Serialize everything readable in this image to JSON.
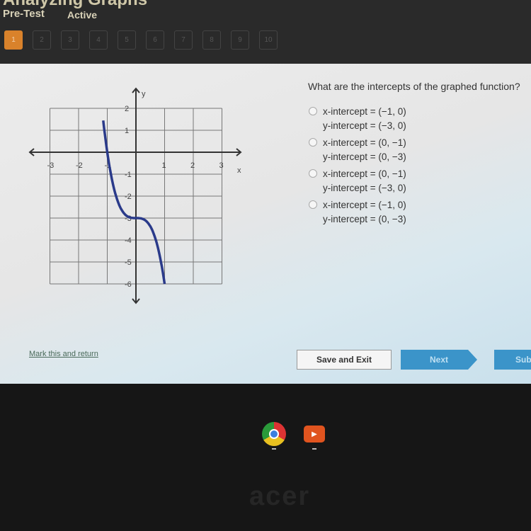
{
  "header": {
    "title": "Analyzing Graphs",
    "mode": "Pre-Test",
    "status": "Active"
  },
  "questions": [
    "1",
    "2",
    "3",
    "4",
    "5",
    "6",
    "7",
    "8",
    "9",
    "10"
  ],
  "current_question": 1,
  "question": "What are the intercepts of the graphed function?",
  "options": [
    {
      "x": "x-intercept = (−1, 0)",
      "y": "y-intercept = (−3, 0)"
    },
    {
      "x": "x-intercept = (0, −1)",
      "y": "y-intercept = (0, −3)"
    },
    {
      "x": "x-intercept = (0, −1)",
      "y": "y-intercept = (−3, 0)"
    },
    {
      "x": "x-intercept = (−1, 0)",
      "y": "y-intercept = (0, −3)"
    }
  ],
  "graph": {
    "xlabel": "x",
    "ylabel": "y",
    "xticks": [
      "-3",
      "-2",
      "-1",
      "1",
      "2",
      "3"
    ],
    "yticks": [
      "2",
      "1",
      "-1",
      "-2",
      "-3",
      "-4",
      "-5",
      "-6"
    ],
    "xlim": [
      -3,
      3
    ],
    "ylim": [
      -6,
      2
    ],
    "function": "y = -3x^3 - 3",
    "curve_color": "#2a3a8a"
  },
  "footer": {
    "mark": "Mark this and return",
    "save": "Save and Exit",
    "next": "Next",
    "submit": "Submit"
  },
  "taskbar": {
    "logo": "acer",
    "apps": [
      "chrome-icon",
      "youtube-icon"
    ]
  }
}
